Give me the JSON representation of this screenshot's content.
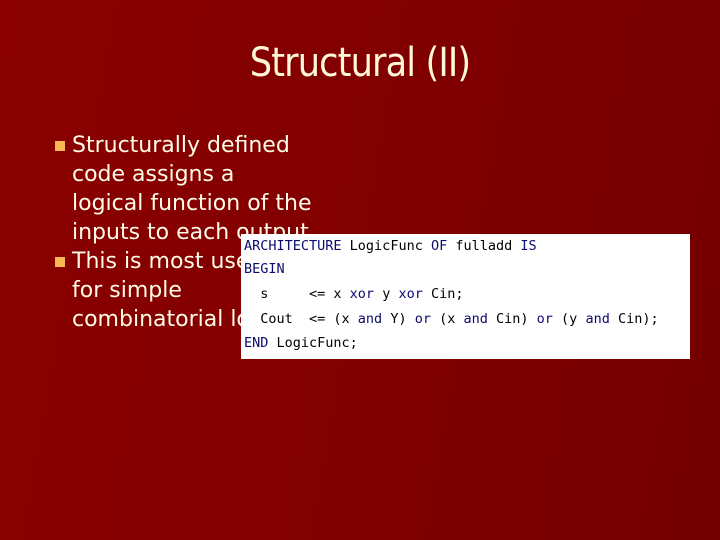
{
  "slide": {
    "title": "Structural (II)",
    "bullets": [
      "Structurally defined code assigns a logical function of the inputs to each output",
      "This is most useful for simple combinatorial logic"
    ],
    "code": {
      "lines": [
        [
          {
            "t": "ARCHITECTURE",
            "k": true
          },
          {
            "t": " LogicFunc "
          },
          {
            "t": "OF",
            "k": true
          },
          {
            "t": " fulladd "
          },
          {
            "t": "IS",
            "k": true
          }
        ],
        [
          {
            "t": "BEGIN",
            "k": true
          }
        ],
        [
          {
            "t": "  s     <= x "
          },
          {
            "t": "xor",
            "k": true
          },
          {
            "t": " y "
          },
          {
            "t": "xor",
            "k": true
          },
          {
            "t": " Cin;"
          }
        ],
        [
          {
            "t": "  Cout  <= (x "
          },
          {
            "t": "and",
            "k": true
          },
          {
            "t": " Y) "
          },
          {
            "t": "or",
            "k": true
          },
          {
            "t": " (x "
          },
          {
            "t": "and",
            "k": true
          },
          {
            "t": " Cin) "
          },
          {
            "t": "or",
            "k": true
          },
          {
            "t": " (y "
          },
          {
            "t": "and",
            "k": true
          },
          {
            "t": " Cin);"
          }
        ],
        [
          {
            "t": "END",
            "k": true
          },
          {
            "t": " LogicFunc;"
          }
        ]
      ]
    },
    "colors": {
      "background": "#820000",
      "title": "#fff8d8",
      "bullet_marker": "#f7b955",
      "keyword": "#0b0b6e"
    }
  }
}
